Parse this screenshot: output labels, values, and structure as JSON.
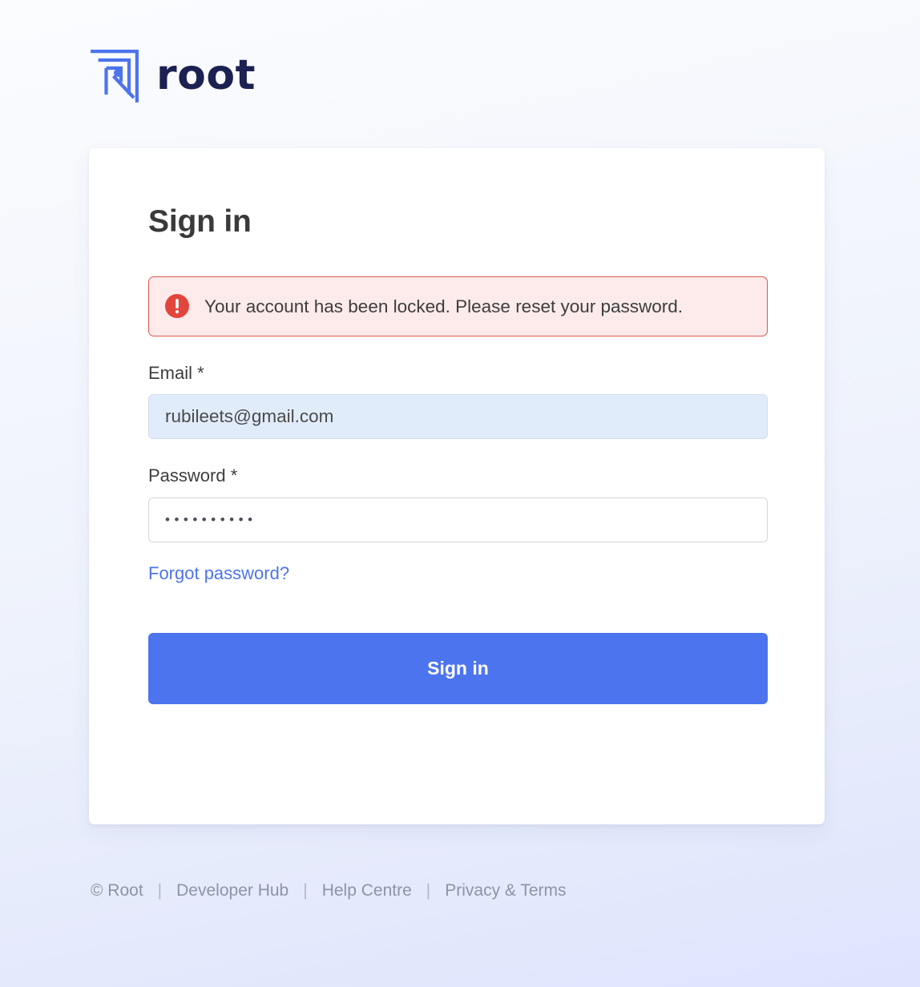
{
  "brand": {
    "logo_icon": "root-logo-icon",
    "wordmark": "root",
    "logo_color": "#4d74ec",
    "wordmark_color": "#1b2150"
  },
  "card": {
    "title": "Sign in",
    "alert": {
      "icon": "error-exclamation-icon",
      "message": "Your account has been locked. Please reset your password.",
      "background_color": "#fcebea",
      "border_color": "#e2584e",
      "icon_color": "#e2453c"
    },
    "email_field": {
      "label": "Email *",
      "value": "rubileets@gmail.com",
      "placeholder": "Email",
      "background_color": "#e1ecfb"
    },
    "password_field": {
      "label": "Password *",
      "value": "••••••••••",
      "placeholder": "Password",
      "background_color": "#ffffff"
    },
    "forgot_password_link": "Forgot password?",
    "forgot_password_color": "#4d74ec",
    "submit_button": {
      "label": "Sign in",
      "background_color": "#4c74ee",
      "text_color": "#ffffff"
    }
  },
  "footer": {
    "copyright": "© Root",
    "separator": "|",
    "links": [
      {
        "label": "Developer Hub"
      },
      {
        "label": "Help Centre"
      },
      {
        "label": "Privacy & Terms"
      }
    ]
  }
}
